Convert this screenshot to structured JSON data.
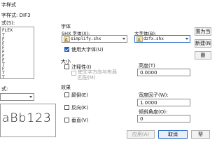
{
  "window": {
    "title": "字样式"
  },
  "current_style": {
    "label": "字样式: ",
    "value": "DIF3"
  },
  "styles": {
    "label": "式(S):",
    "items": [
      "FLEX",
      "T",
      "F",
      "F",
      "F",
      "F",
      "F",
      "F",
      "T",
      "F",
      "T",
      "T"
    ]
  },
  "filter": {
    "label": "式:"
  },
  "preview": {
    "text": "aBb123"
  },
  "font_group": {
    "title": "字体",
    "shx_label": "SHX 字体(X):",
    "shx_value": "simplify.shx",
    "bigfont_label": "大字体(B):",
    "bigfont_value": "dzfx.shx",
    "use_bigfont_label": "使用大字体(U)",
    "use_bigfont_checked": true
  },
  "size_group": {
    "title": "大小",
    "annotative_label": "注释性(I)",
    "annotative_checked": false,
    "match_orientation_label": "使文字方向与布局匹配(M)",
    "height_label": "高度(T)",
    "height_value": "0.0000"
  },
  "effects_group": {
    "title": "效果",
    "upside_down_label": "颠倒(E)",
    "backwards_label": "反向(K)",
    "vertical_label": "垂直(V)",
    "width_factor_label": "宽度因子(W):",
    "width_factor_value": "1.0000",
    "oblique_label": "倾斜角度(O):",
    "oblique_value": "0"
  },
  "buttons": {
    "set_current": "置为当",
    "new": "新建(N",
    "delete": "删",
    "apply": "应用(A)",
    "cancel": "取消",
    "help": "帮"
  },
  "colors": {
    "accent": "#1f5fb5",
    "focus_border": "#2b6cc4"
  }
}
